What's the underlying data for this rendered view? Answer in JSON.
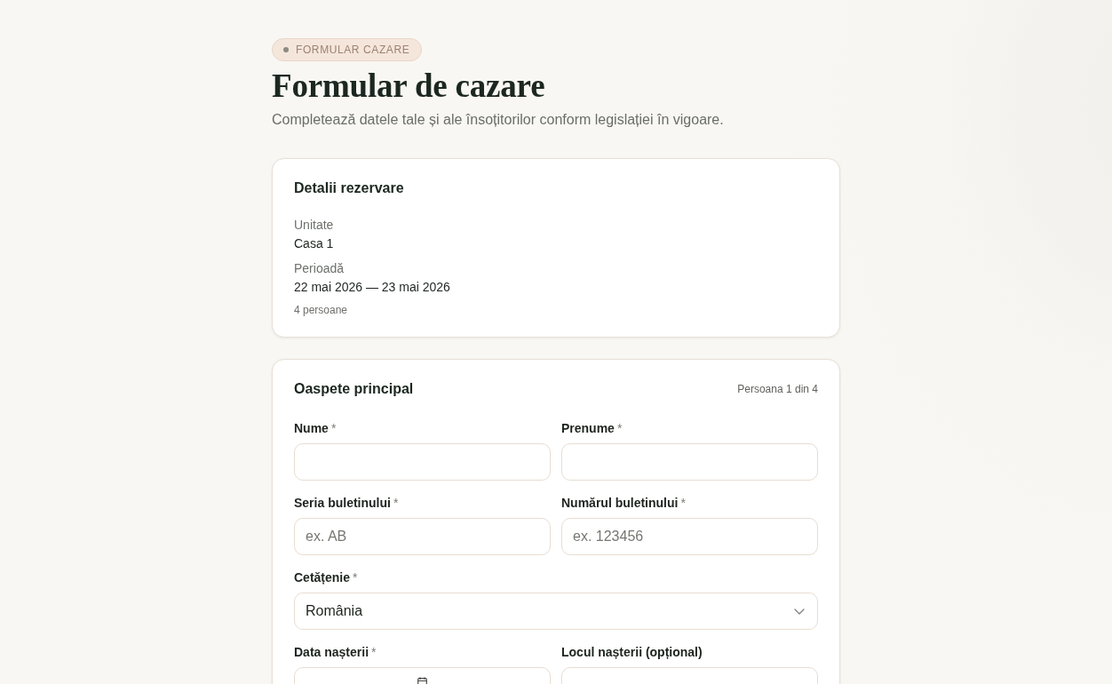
{
  "eyebrow": {
    "label": "FORMULAR CAZARE"
  },
  "heading": {
    "title": "Formular de cazare",
    "subtitle": "Completează datele tale și ale însoțitorilor conform legislației în vigoare."
  },
  "booking": {
    "title": "Detalii rezervare",
    "items": [
      {
        "label": "Unitate",
        "value": "Casa 1"
      },
      {
        "label": "Perioadă",
        "value": "22 mai 2026 — 23 mai 2026"
      }
    ],
    "note": "4 persoane"
  },
  "guest": {
    "title": "Oaspete principal",
    "counter": "Persoana 1 din 4",
    "rows": [
      [
        {
          "kind": "text",
          "label": "Nume",
          "required_mark": "*"
        },
        {
          "kind": "text",
          "label": "Prenume",
          "required_mark": "*"
        }
      ],
      [
        {
          "kind": "text",
          "label": "Seria buletinului",
          "required_mark": "*",
          "placeholder": "ex. AB"
        },
        {
          "kind": "text",
          "label": "Numărul buletinului",
          "required_mark": "*",
          "placeholder": "ex. 123456"
        }
      ],
      [
        {
          "kind": "select",
          "label": "Cetățenie",
          "required_mark": "*",
          "value": "România"
        }
      ],
      [
        {
          "kind": "date",
          "label": "Data nașterii",
          "required_mark": "*"
        },
        {
          "kind": "text",
          "label": "Locul nașterii (opțional)"
        }
      ]
    ]
  }
}
